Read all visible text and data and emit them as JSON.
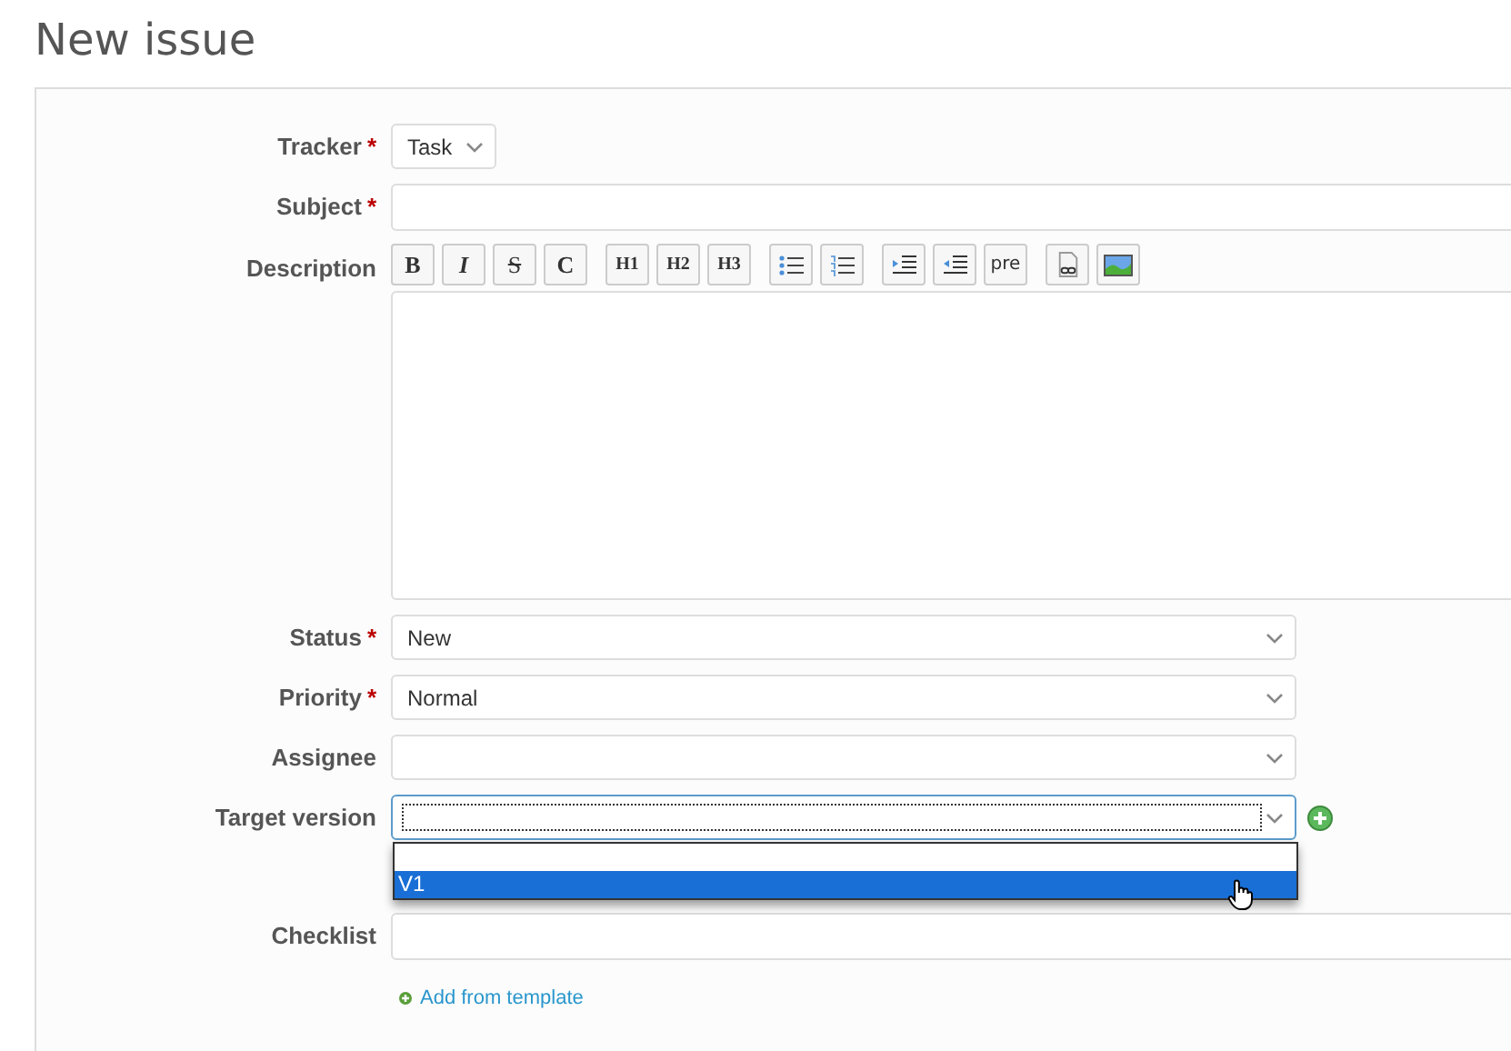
{
  "title": "New issue",
  "fields": [
    {
      "label": "Tracker",
      "required_mark": "*",
      "kind": "small_select",
      "value": "Task"
    },
    {
      "label": "Subject",
      "required_mark": "*",
      "kind": "text"
    },
    {
      "label": "Description",
      "kind": "editor",
      "toolbar": [
        [
          {
            "kind": "bold",
            "label": "B"
          },
          {
            "kind": "italic",
            "label": "I"
          },
          {
            "kind": "strike",
            "label": "S"
          },
          {
            "kind": "code",
            "label": "C"
          }
        ],
        [
          {
            "kind": "heading",
            "label": "H1"
          },
          {
            "kind": "heading",
            "label": "H2"
          },
          {
            "kind": "heading",
            "label": "H3"
          }
        ],
        [
          {
            "kind": "bullet_list"
          },
          {
            "kind": "numbered_list"
          }
        ],
        [
          {
            "kind": "indent"
          },
          {
            "kind": "outdent"
          },
          {
            "kind": "plain",
            "label": "pre"
          }
        ],
        [
          {
            "kind": "link"
          },
          {
            "kind": "image"
          }
        ]
      ]
    },
    {
      "label": "Status",
      "required_mark": "*",
      "kind": "select",
      "value": "New"
    },
    {
      "label": "Priority",
      "required_mark": "*",
      "kind": "select",
      "value": "Normal"
    },
    {
      "label": "Assignee",
      "kind": "select"
    },
    {
      "label": "Target version",
      "kind": "select",
      "focused": true,
      "add_button": true,
      "options": [
        {
          "selected": false
        },
        {
          "label": "V1",
          "selected": true
        }
      ]
    },
    {
      "label": "Checklist",
      "kind": "text"
    }
  ],
  "add_link": "Add from template"
}
